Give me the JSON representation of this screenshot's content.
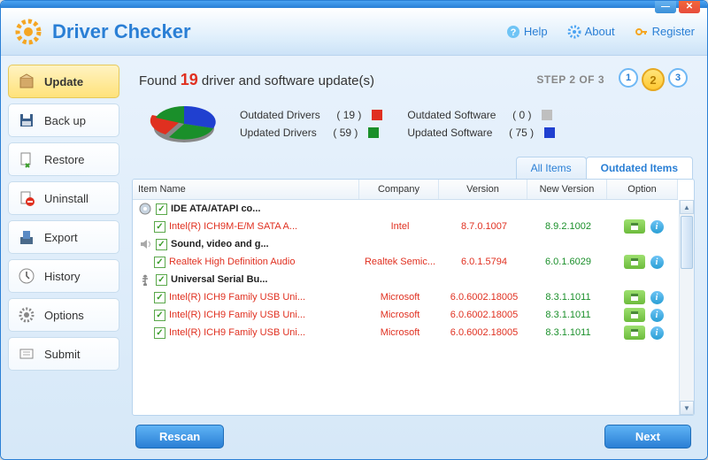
{
  "app_title": "Driver Checker",
  "toplinks": {
    "help": "Help",
    "about": "About",
    "register": "Register"
  },
  "sidebar": [
    {
      "key": "update",
      "label": "Update"
    },
    {
      "key": "backup",
      "label": "Back up"
    },
    {
      "key": "restore",
      "label": "Restore"
    },
    {
      "key": "uninstall",
      "label": "Uninstall"
    },
    {
      "key": "export",
      "label": "Export"
    },
    {
      "key": "history",
      "label": "History"
    },
    {
      "key": "options",
      "label": "Options"
    },
    {
      "key": "submit",
      "label": "Submit"
    }
  ],
  "found": {
    "prefix": "Found ",
    "count": "19",
    "suffix": " driver and software update(s)"
  },
  "step": {
    "label": "STEP 2 OF 3",
    "s1": "1",
    "s2": "2",
    "s3": "3"
  },
  "legend": {
    "outdated_drivers": {
      "label": "Outdated Drivers",
      "count": "( 19 )",
      "color": "#e03020"
    },
    "updated_drivers": {
      "label": "Updated Drivers",
      "count": "( 59 )",
      "color": "#1a8f2a"
    },
    "outdated_software": {
      "label": "Outdated Software",
      "count": "( 0 )",
      "color": "#bfbfbf"
    },
    "updated_software": {
      "label": "Updated Software",
      "count": "( 75 )",
      "color": "#2040d0"
    }
  },
  "tabs": {
    "all": "All Items",
    "outdated": "Outdated Items"
  },
  "columns": {
    "name": "Item Name",
    "company": "Company",
    "version": "Version",
    "newversion": "New Version",
    "option": "Option"
  },
  "groups": [
    {
      "title": "IDE ATA/ATAPI co...",
      "icon": "disc",
      "rows": [
        {
          "name": "Intel(R) ICH9M-E/M SATA A...",
          "company": "Intel",
          "version": "8.7.0.1007",
          "newversion": "8.9.2.1002"
        }
      ]
    },
    {
      "title": "Sound, video and g...",
      "icon": "speaker",
      "rows": [
        {
          "name": "Realtek High Definition Audio",
          "company": "Realtek Semic...",
          "version": "6.0.1.5794",
          "newversion": "6.0.1.6029"
        }
      ]
    },
    {
      "title": "Universal Serial Bu...",
      "icon": "usb",
      "rows": [
        {
          "name": "Intel(R) ICH9 Family USB Uni...",
          "company": "Microsoft",
          "version": "6.0.6002.18005",
          "newversion": "8.3.1.1011"
        },
        {
          "name": "Intel(R) ICH9 Family USB Uni...",
          "company": "Microsoft",
          "version": "6.0.6002.18005",
          "newversion": "8.3.1.1011"
        },
        {
          "name": "Intel(R) ICH9 Family USB Uni...",
          "company": "Microsoft",
          "version": "6.0.6002.18005",
          "newversion": "8.3.1.1011"
        }
      ]
    }
  ],
  "buttons": {
    "rescan": "Rescan",
    "next": "Next"
  },
  "chart_data": {
    "type": "pie",
    "title": "",
    "series": [
      {
        "name": "Outdated Drivers",
        "value": 19,
        "color": "#e03020"
      },
      {
        "name": "Updated Drivers",
        "value": 59,
        "color": "#1a8f2a"
      },
      {
        "name": "Outdated Software",
        "value": 0,
        "color": "#bfbfbf"
      },
      {
        "name": "Updated Software",
        "value": 75,
        "color": "#2040d0"
      }
    ]
  }
}
